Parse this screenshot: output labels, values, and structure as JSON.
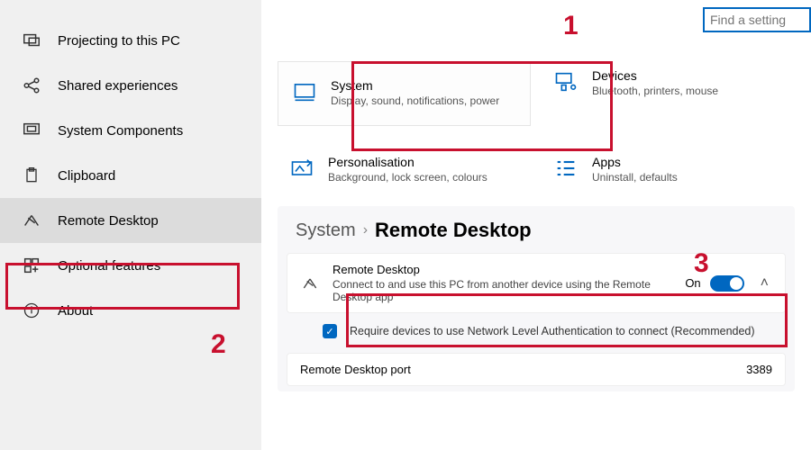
{
  "search": {
    "placeholder": "Find a setting"
  },
  "sidebar": {
    "items": [
      {
        "label": "Projecting to this PC"
      },
      {
        "label": "Shared experiences"
      },
      {
        "label": "System Components"
      },
      {
        "label": "Clipboard"
      },
      {
        "label": "Remote Desktop"
      },
      {
        "label": "Optional features"
      },
      {
        "label": "About"
      }
    ]
  },
  "tiles": {
    "system": {
      "title": "System",
      "sub": "Display, sound, notifications, power"
    },
    "devices": {
      "title": "Devices",
      "sub": "Bluetooth, printers, mouse"
    },
    "personalisation": {
      "title": "Personalisation",
      "sub": "Background, lock screen, colours"
    },
    "apps": {
      "title": "Apps",
      "sub": "Uninstall, defaults"
    }
  },
  "breadcrumb": {
    "root": "System",
    "sep": "›",
    "current": "Remote Desktop"
  },
  "remote": {
    "title": "Remote Desktop",
    "desc": "Connect to and use this PC from another device using the Remote Desktop app",
    "state_label": "On",
    "nla_label": "Require devices to use Network Level Authentication to connect (Recommended)",
    "port_label": "Remote Desktop port",
    "port_value": "3389"
  },
  "annotations": {
    "one": "1",
    "two": "2",
    "three": "3"
  }
}
